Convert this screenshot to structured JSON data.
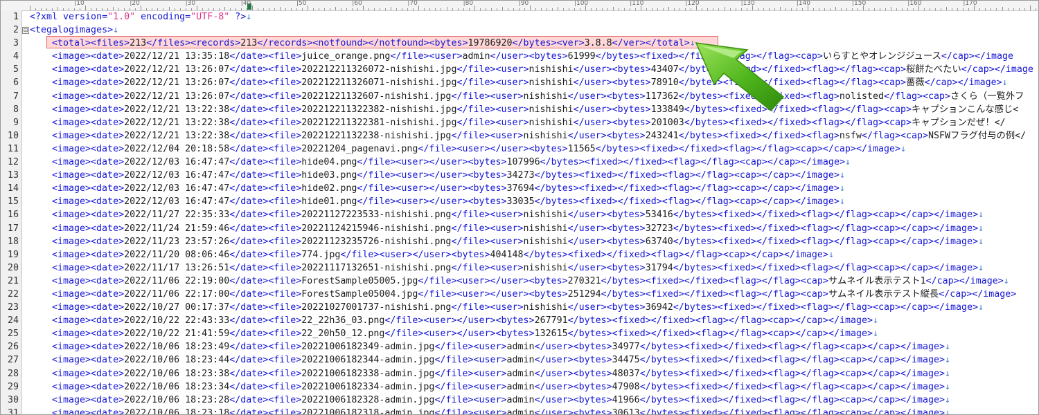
{
  "ruler": {
    "labels": [
      "|10",
      "|20",
      "|30",
      "|40",
      "|50",
      "|60",
      "|70",
      "|80",
      "|90",
      "|100",
      "|110",
      "|120",
      "|130",
      "|140",
      "|150",
      "|160",
      "|170",
      "|180"
    ]
  },
  "lines": [
    {
      "n": "1",
      "indent": 0,
      "fold": "",
      "code": "<?xml version=\"1.0\" encoding=\"UTF-8\" ?>↓"
    },
    {
      "n": "2",
      "indent": 0,
      "fold": "⊟",
      "code": "<tegalogimages>↓"
    },
    {
      "n": "3",
      "indent": 1,
      "fold": "",
      "code": "<total><files>213</files><records>213</records><notfound></notfound><bytes>19786920</bytes><ver>3.8.8</ver></total>↓"
    },
    {
      "n": "4",
      "indent": 1,
      "fold": "",
      "code": "<image><date>2022/12/21 13:35:18</date><file>juice_orange.png</file><user>admin</user><bytes>61999</bytes><fixed></fixed><flag></flag><cap>いらすとやオレンジジュース</cap></image"
    },
    {
      "n": "5",
      "indent": 1,
      "fold": "",
      "code": "<image><date>2022/12/21 13:26:07</date><file>202212211326072-nishishi.jpg</file><user>nishishi</user><bytes>43407</bytes><fixed></fixed><flag></flag><cap>桜餅たべたい</cap></image"
    },
    {
      "n": "6",
      "indent": 1,
      "fold": "",
      "code": "<image><date>2022/12/21 13:26:07</date><file>202212211326071-nishishi.jpg</file><user>nishishi</user><bytes>78910</bytes><fixed></fixed><flag></flag><cap>薔薇</cap></image>↓"
    },
    {
      "n": "7",
      "indent": 1,
      "fold": "",
      "code": "<image><date>2022/12/21 13:26:07</date><file>20221221132607-nishishi.jpg</file><user>nishishi</user><bytes>117362</bytes><fixed></fixed><flag>nolisted</flag><cap>さくら（一覧外フ"
    },
    {
      "n": "8",
      "indent": 1,
      "fold": "",
      "code": "<image><date>2022/12/21 13:22:38</date><file>202212211322382-nishishi.jpg</file><user>nishishi</user><bytes>133849</bytes><fixed></fixed><flag></flag><cap>キャプションこんな感じ<"
    },
    {
      "n": "9",
      "indent": 1,
      "fold": "",
      "code": "<image><date>2022/12/21 13:22:38</date><file>202212211322381-nishishi.jpg</file><user>nishishi</user><bytes>201003</bytes><fixed></fixed><flag></flag><cap>キャプションだぜ！</"
    },
    {
      "n": "10",
      "indent": 1,
      "fold": "",
      "code": "<image><date>2022/12/21 13:22:38</date><file>20221221132238-nishishi.jpg</file><user>nishishi</user><bytes>243241</bytes><fixed></fixed><flag>nsfw</flag><cap>NSFWフラグ付与の例</"
    },
    {
      "n": "11",
      "indent": 1,
      "fold": "",
      "code": "<image><date>2022/12/04 20:18:58</date><file>20221204_pagenavi.png</file><user></user><bytes>11565</bytes><fixed></fixed><flag></flag><cap></cap></image>↓"
    },
    {
      "n": "12",
      "indent": 1,
      "fold": "",
      "code": "<image><date>2022/12/03 16:47:47</date><file>hide04.png</file><user></user><bytes>107996</bytes><fixed></fixed><flag></flag><cap></cap></image>↓"
    },
    {
      "n": "13",
      "indent": 1,
      "fold": "",
      "code": "<image><date>2022/12/03 16:47:47</date><file>hide03.png</file><user></user><bytes>34273</bytes><fixed></fixed><flag></flag><cap></cap></image>↓"
    },
    {
      "n": "14",
      "indent": 1,
      "fold": "",
      "code": "<image><date>2022/12/03 16:47:47</date><file>hide02.png</file><user></user><bytes>37694</bytes><fixed></fixed><flag></flag><cap></cap></image>↓"
    },
    {
      "n": "15",
      "indent": 1,
      "fold": "",
      "code": "<image><date>2022/12/03 16:47:47</date><file>hide01.png</file><user></user><bytes>33035</bytes><fixed></fixed><flag></flag><cap></cap></image>↓"
    },
    {
      "n": "16",
      "indent": 1,
      "fold": "",
      "code": "<image><date>2022/11/27 22:35:33</date><file>20221127223533-nishishi.png</file><user>nishishi</user><bytes>53416</bytes><fixed></fixed><flag></flag><cap></cap></image>↓"
    },
    {
      "n": "17",
      "indent": 1,
      "fold": "",
      "code": "<image><date>2022/11/24 21:59:46</date><file>20221124215946-nishishi.png</file><user>nishishi</user><bytes>32723</bytes><fixed></fixed><flag></flag><cap></cap></image>↓"
    },
    {
      "n": "18",
      "indent": 1,
      "fold": "",
      "code": "<image><date>2022/11/23 23:57:26</date><file>20221123235726-nishishi.png</file><user>nishishi</user><bytes>63740</bytes><fixed></fixed><flag></flag><cap></cap></image>↓"
    },
    {
      "n": "19",
      "indent": 1,
      "fold": "",
      "code": "<image><date>2022/11/20 08:06:46</date><file>774.jpg</file><user></user><bytes>404148</bytes><fixed></fixed><flag></flag><cap></cap></image>↓"
    },
    {
      "n": "20",
      "indent": 1,
      "fold": "",
      "code": "<image><date>2022/11/17 13:26:51</date><file>20221117132651-nishishi.png</file><user>nishishi</user><bytes>31794</bytes><fixed></fixed><flag></flag><cap></cap></image>↓"
    },
    {
      "n": "21",
      "indent": 1,
      "fold": "",
      "code": "<image><date>2022/11/06 22:19:00</date><file>ForestSample05005.jpg</file><user></user><bytes>270321</bytes><fixed></fixed><flag></flag><cap>サムネイル表示テスト1</cap></image>↓"
    },
    {
      "n": "22",
      "indent": 1,
      "fold": "",
      "code": "<image><date>2022/11/06 22:17:00</date><file>ForestSample05004.jpg</file><user></user><bytes>251294</bytes><fixed></fixed><flag></flag><cap>サムネイル表示テスト縦長</cap></image>"
    },
    {
      "n": "23",
      "indent": 1,
      "fold": "",
      "code": "<image><date>2022/10/27 00:17:37</date><file>20221027001737-nishishi.png</file><user>nishishi</user><bytes>36942</bytes><fixed></fixed><flag></flag><cap></cap></image>↓"
    },
    {
      "n": "24",
      "indent": 1,
      "fold": "",
      "code": "<image><date>2022/10/22 22:43:33</date><file>22_22h36_03.png</file><user></user><bytes>267791</bytes><fixed></fixed><flag></flag><cap></cap></image>↓"
    },
    {
      "n": "25",
      "indent": 1,
      "fold": "",
      "code": "<image><date>2022/10/22 21:41:59</date><file>22_20h50_12.png</file><user></user><bytes>132615</bytes><fixed></fixed><flag></flag><cap></cap></image>↓"
    },
    {
      "n": "26",
      "indent": 1,
      "fold": "",
      "code": "<image><date>2022/10/06 18:23:49</date><file>20221006182349-admin.jpg</file><user>admin</user><bytes>34977</bytes><fixed></fixed><flag></flag><cap></cap></image>↓"
    },
    {
      "n": "27",
      "indent": 1,
      "fold": "",
      "code": "<image><date>2022/10/06 18:23:44</date><file>20221006182344-admin.jpg</file><user>admin</user><bytes>34475</bytes><fixed></fixed><flag></flag><cap></cap></image>↓"
    },
    {
      "n": "28",
      "indent": 1,
      "fold": "",
      "code": "<image><date>2022/10/06 18:23:38</date><file>20221006182338-admin.jpg</file><user>admin</user><bytes>48037</bytes><fixed></fixed><flag></flag><cap></cap></image>↓"
    },
    {
      "n": "29",
      "indent": 1,
      "fold": "",
      "code": "<image><date>2022/10/06 18:23:34</date><file>20221006182334-admin.jpg</file><user>admin</user><bytes>47908</bytes><fixed></fixed><flag></flag><cap></cap></image>↓"
    },
    {
      "n": "30",
      "indent": 1,
      "fold": "",
      "code": "<image><date>2022/10/06 18:23:28</date><file>20221006182328-admin.jpg</file><user>admin</user><bytes>41966</bytes><fixed></fixed><flag></flag><cap></cap></image>↓"
    },
    {
      "n": "31",
      "indent": 1,
      "fold": "",
      "code": "<image><date>2022/10/06 18:23:18</date><file>20221006182318-admin.jpg</file><user>admin</user><bytes>30613</bytes><fixed></fixed><flag></flag><cap></cap></image>↓"
    }
  ],
  "colors": {
    "tag": "#1515d6",
    "string": "#e0308a",
    "eol": "#3d7ad6",
    "highlight_bg": "#ffd7d7",
    "highlight_border": "#e26a6a",
    "arrow": "#5cc21a"
  },
  "annotation": {
    "icon": "arrow-pointing-up-left-icon",
    "highlighted_line": "3"
  }
}
